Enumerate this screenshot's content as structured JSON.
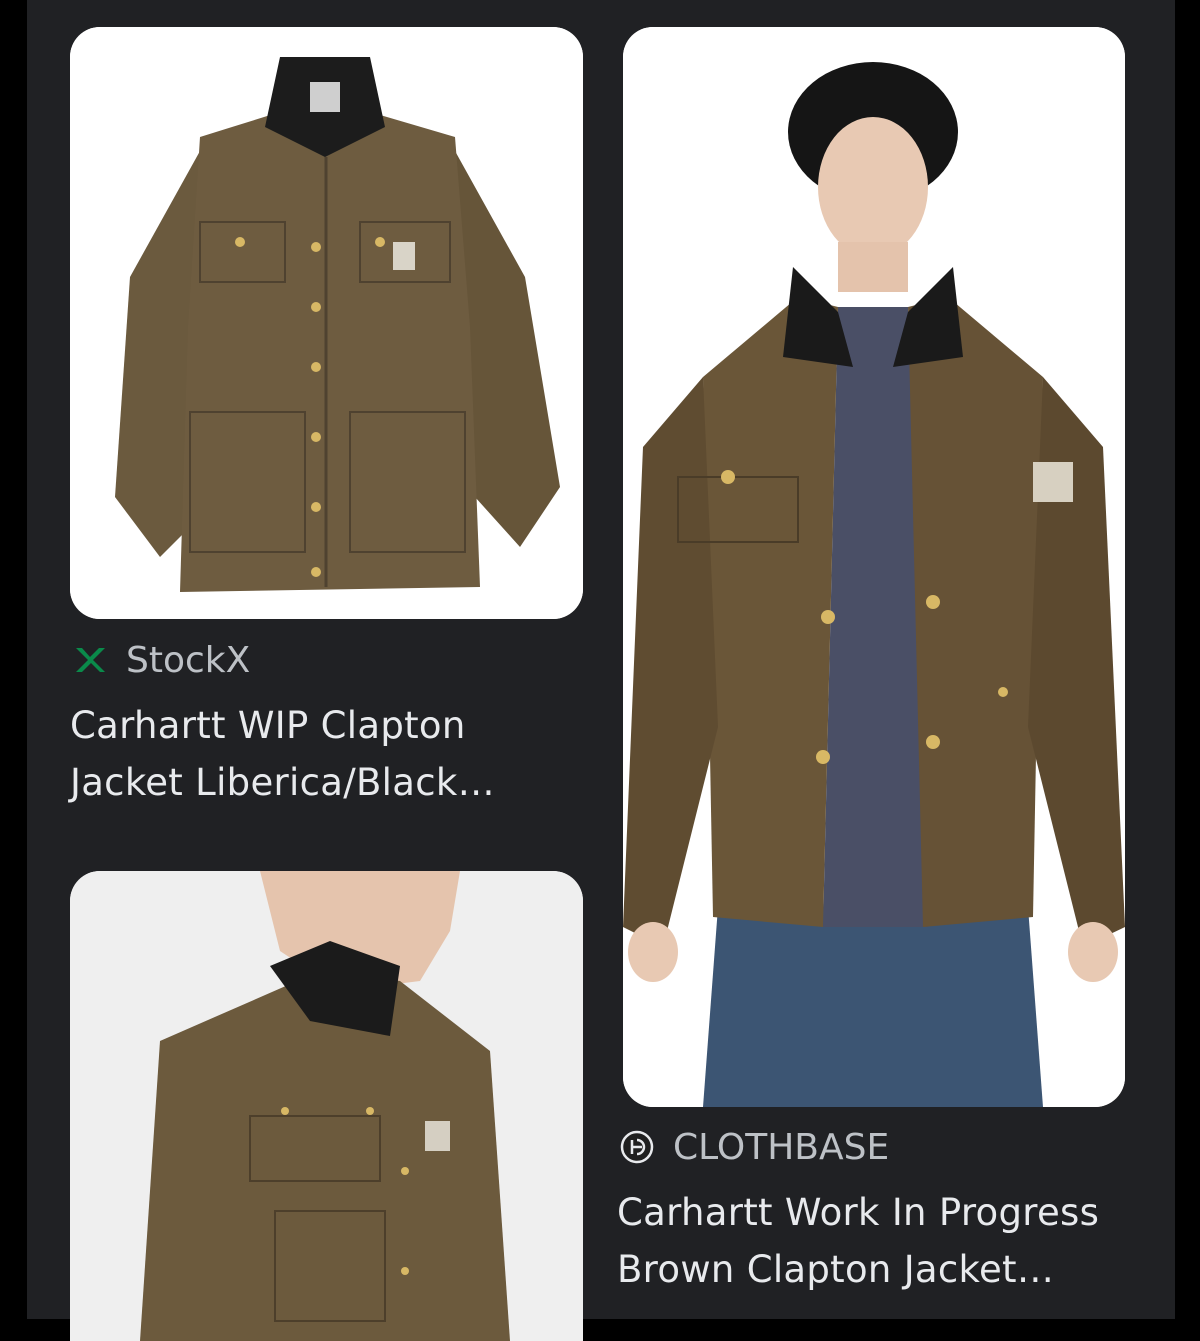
{
  "results": [
    {
      "source": "StockX",
      "source_icon": "stockx-x-icon",
      "title_line1": "Carhartt WIP Clapton",
      "title_line2": "Jacket Liberica/Black…"
    },
    {
      "source": "CLOTHBASE",
      "source_icon": "clothbase-logo-icon",
      "title_line1": "Carhartt Work In Progress",
      "title_line2": "Brown Clapton Jacket…"
    },
    {
      "source": "",
      "title_line1": "",
      "title_line2": ""
    }
  ],
  "colors": {
    "background": "#202124",
    "source_text": "#bdc1c6",
    "title_text": "#e8eaed",
    "stockx_green": "#0a8a4a",
    "jacket_brown": "#6b5a3e",
    "collar_black": "#1c1c1c"
  }
}
